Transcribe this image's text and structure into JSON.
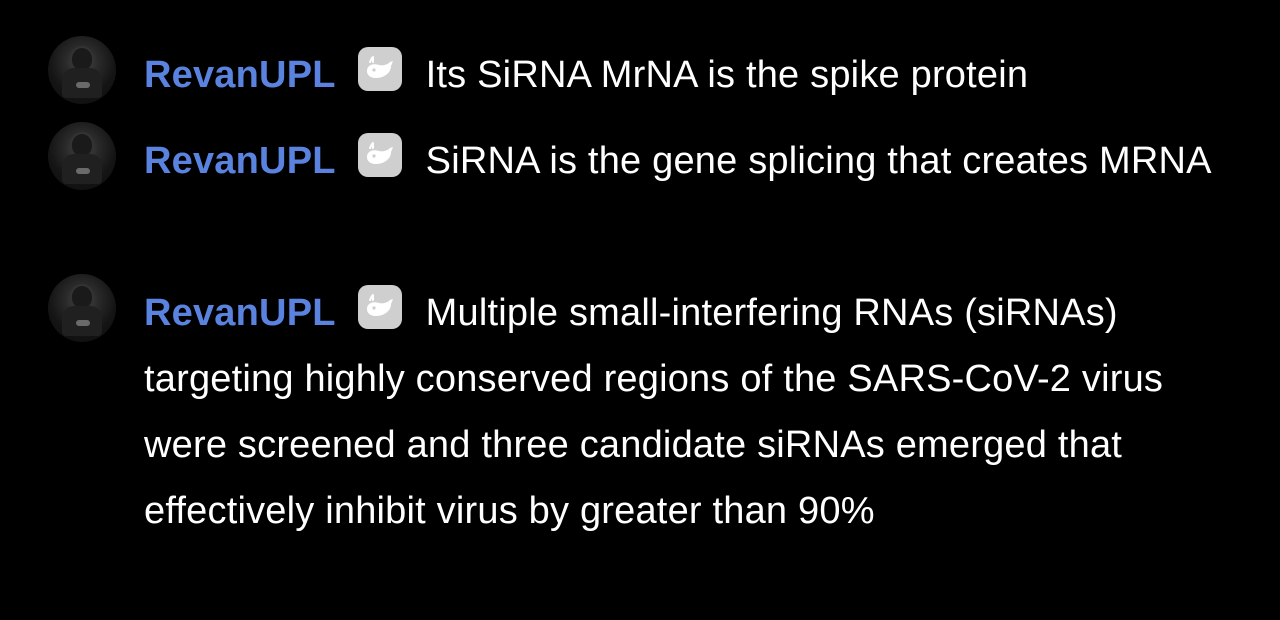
{
  "messages": [
    {
      "username": "RevanUPL",
      "avatar_icon": "user-avatar-icon",
      "badge_icon": "whale-badge-icon",
      "text": "Its SiRNA MrNA is the spike protein"
    },
    {
      "username": "RevanUPL",
      "avatar_icon": "user-avatar-icon",
      "badge_icon": "whale-badge-icon",
      "text": "SiRNA is the gene splicing that creates MRNA"
    },
    {
      "username": "RevanUPL",
      "avatar_icon": "user-avatar-icon",
      "badge_icon": "whale-badge-icon",
      "text": "Multiple small-interfering RNAs (siRNAs) targeting highly conserved regions of the SARS-CoV-2 virus were screened and three candidate siRNAs emerged that effectively inhibit virus by greater than 90%"
    }
  ],
  "colors": {
    "background": "#000000",
    "username": "#5a83e0",
    "text": "#ffffff",
    "badge": "#cfcfcf"
  }
}
